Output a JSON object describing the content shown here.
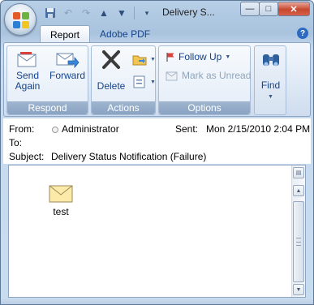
{
  "window": {
    "title": "Delivery S...",
    "controls": {
      "minimize": "—",
      "restore": "□",
      "close": "✕"
    }
  },
  "colors": {
    "accent": "#15428b",
    "frame": "#a9c3de",
    "group_label": "#8aa3c2"
  },
  "qat": {
    "icons": [
      "save-icon",
      "undo-icon",
      "redo-icon",
      "previous-item-icon",
      "next-item-icon",
      "customize-qat-icon"
    ]
  },
  "tabs": [
    {
      "label": "Report",
      "active": true
    },
    {
      "label": "Adobe PDF",
      "active": false
    }
  ],
  "ribbon": {
    "respond": {
      "label": "Respond",
      "send_again": {
        "line1": "Send",
        "line2": "Again"
      },
      "forward": "Forward"
    },
    "actions": {
      "label": "Actions",
      "delete": "Delete"
    },
    "options": {
      "label": "Options",
      "follow_up": "Follow Up",
      "mark_unread": "Mark as Unread"
    },
    "find": {
      "label": "Find"
    }
  },
  "header": {
    "from_label": "From:",
    "from_value": "Administrator",
    "sent_label": "Sent:",
    "sent_value": "Mon 2/15/2010 2:04 PM",
    "to_label": "To:",
    "subject_label": "Subject:",
    "subject_value": "Delivery Status Notification (Failure)"
  },
  "body": {
    "attachment": {
      "name": "test",
      "icon": "envelope-icon"
    }
  }
}
